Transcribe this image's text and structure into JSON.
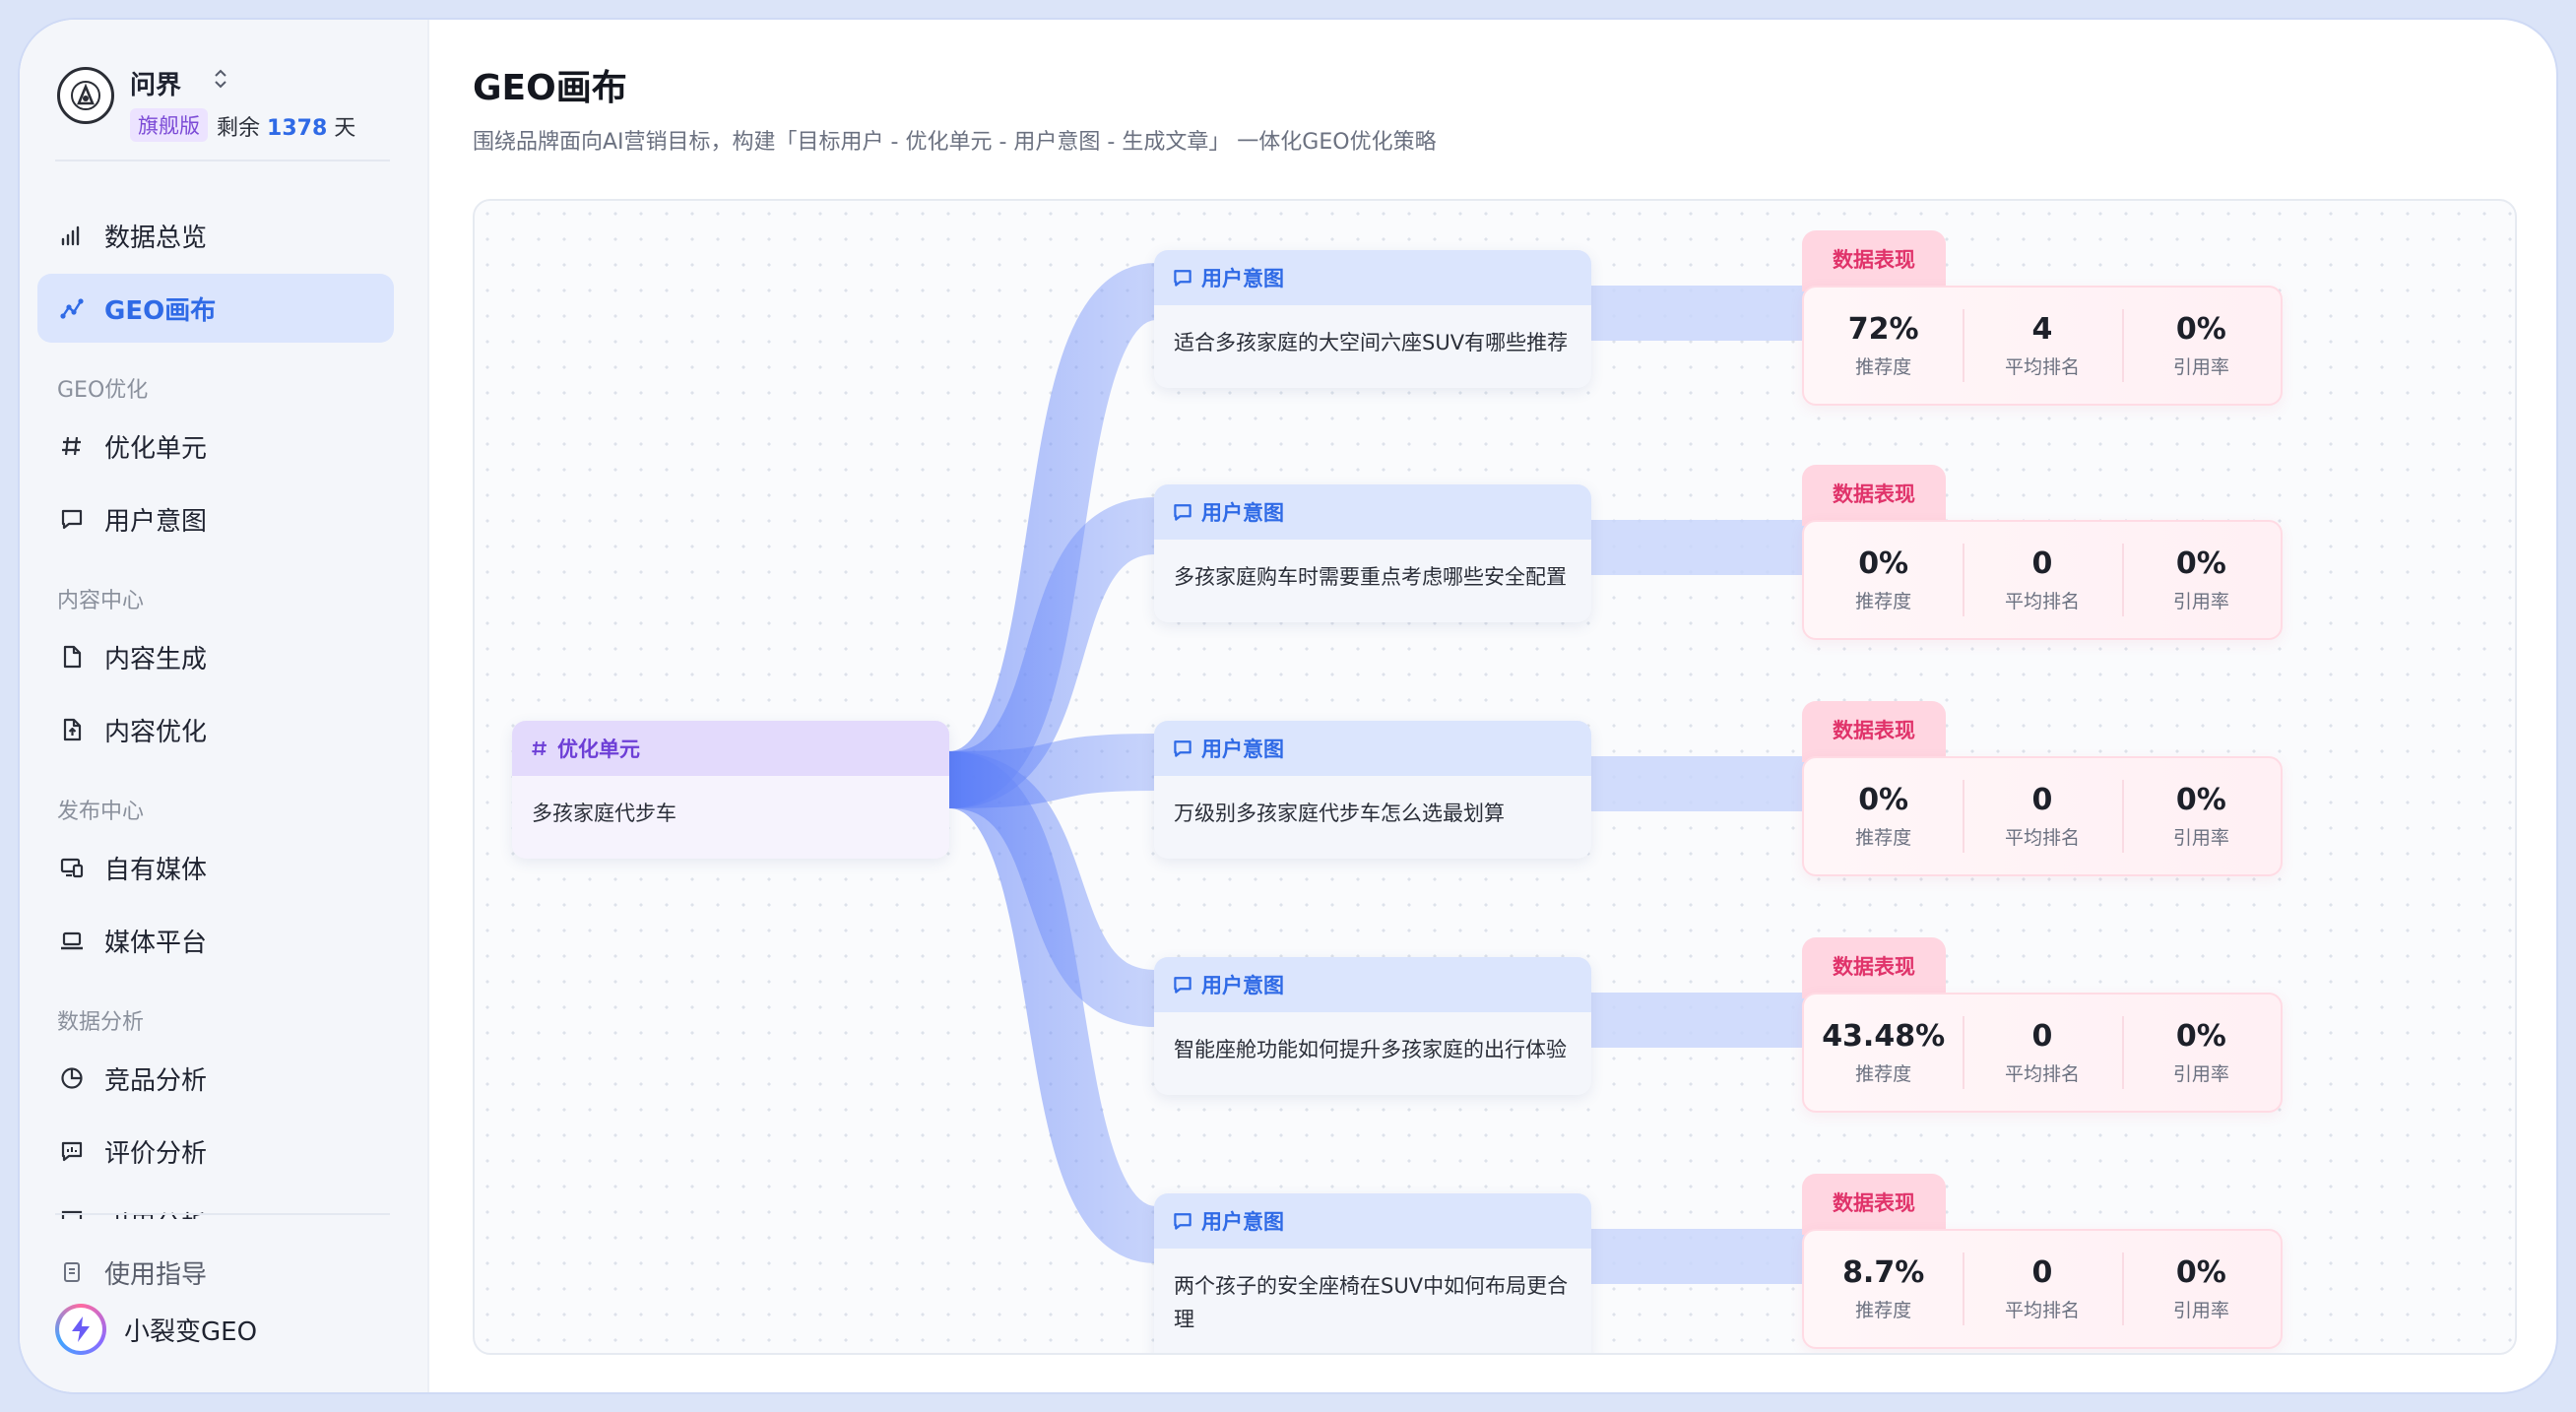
{
  "app": {
    "name": "问界",
    "edition_badge": "旗舰版",
    "remaining_prefix": "剩余",
    "remaining_days": "1378",
    "remaining_suffix": "天"
  },
  "sidebar": {
    "items": [
      {
        "label": "数据总览",
        "icon": "bar-chart-icon"
      },
      {
        "label": "GEO画布",
        "icon": "graph-icon",
        "active": true
      }
    ],
    "sections": [
      {
        "title": "GEO优化",
        "items": [
          {
            "label": "优化单元",
            "icon": "hash-icon"
          },
          {
            "label": "用户意图",
            "icon": "message-icon"
          }
        ]
      },
      {
        "title": "内容中心",
        "items": [
          {
            "label": "内容生成",
            "icon": "file-icon"
          },
          {
            "label": "内容优化",
            "icon": "file-upload-icon"
          }
        ]
      },
      {
        "title": "发布中心",
        "items": [
          {
            "label": "自有媒体",
            "icon": "devices-icon"
          },
          {
            "label": "媒体平台",
            "icon": "laptop-icon"
          }
        ]
      },
      {
        "title": "数据分析",
        "items": [
          {
            "label": "竞品分析",
            "icon": "pie-chart-icon"
          },
          {
            "label": "评价分析",
            "icon": "comment-chart-icon"
          },
          {
            "label": "引用分析",
            "icon": "citation-icon"
          }
        ]
      }
    ],
    "footer_items": [
      {
        "label": "使用指导",
        "icon": "guide-icon"
      }
    ],
    "assistant_label": "小裂变GEO"
  },
  "header": {
    "title": "GEO画布",
    "subtitle": "围绕品牌面向AI营销目标，构建「目标用户 - 优化单元 - 用户意图 - 生成文章」 一体化GEO优化策略"
  },
  "canvas": {
    "unit": {
      "tag": "优化单元",
      "text": "多孩家庭代步车"
    },
    "intent_tag": "用户意图",
    "metrics_tag": "数据表现",
    "metric_labels": {
      "recommend": "推荐度",
      "rank": "平均排名",
      "citation": "引用率"
    },
    "intents": [
      {
        "text": "适合多孩家庭的大空间六座SUV有哪些推荐",
        "recommend": "72%",
        "rank": "4",
        "citation": "0%"
      },
      {
        "text": "多孩家庭购车时需要重点考虑哪些安全配置",
        "recommend": "0%",
        "rank": "0",
        "citation": "0%"
      },
      {
        "text": "万级别多孩家庭代步车怎么选最划算",
        "recommend": "0%",
        "rank": "0",
        "citation": "0%"
      },
      {
        "text": "智能座舱功能如何提升多孩家庭的出行体验",
        "recommend": "43.48%",
        "rank": "0",
        "citation": "0%"
      },
      {
        "text": "两个孩子的安全座椅在SUV中如何布局更合理",
        "recommend": "8.7%",
        "rank": "0",
        "citation": "0%"
      }
    ]
  },
  "colors": {
    "accent": "#2f6ae6",
    "unit_accent": "#6d3fd6",
    "metric_accent": "#e0336a",
    "link": "#6f8ff8"
  }
}
